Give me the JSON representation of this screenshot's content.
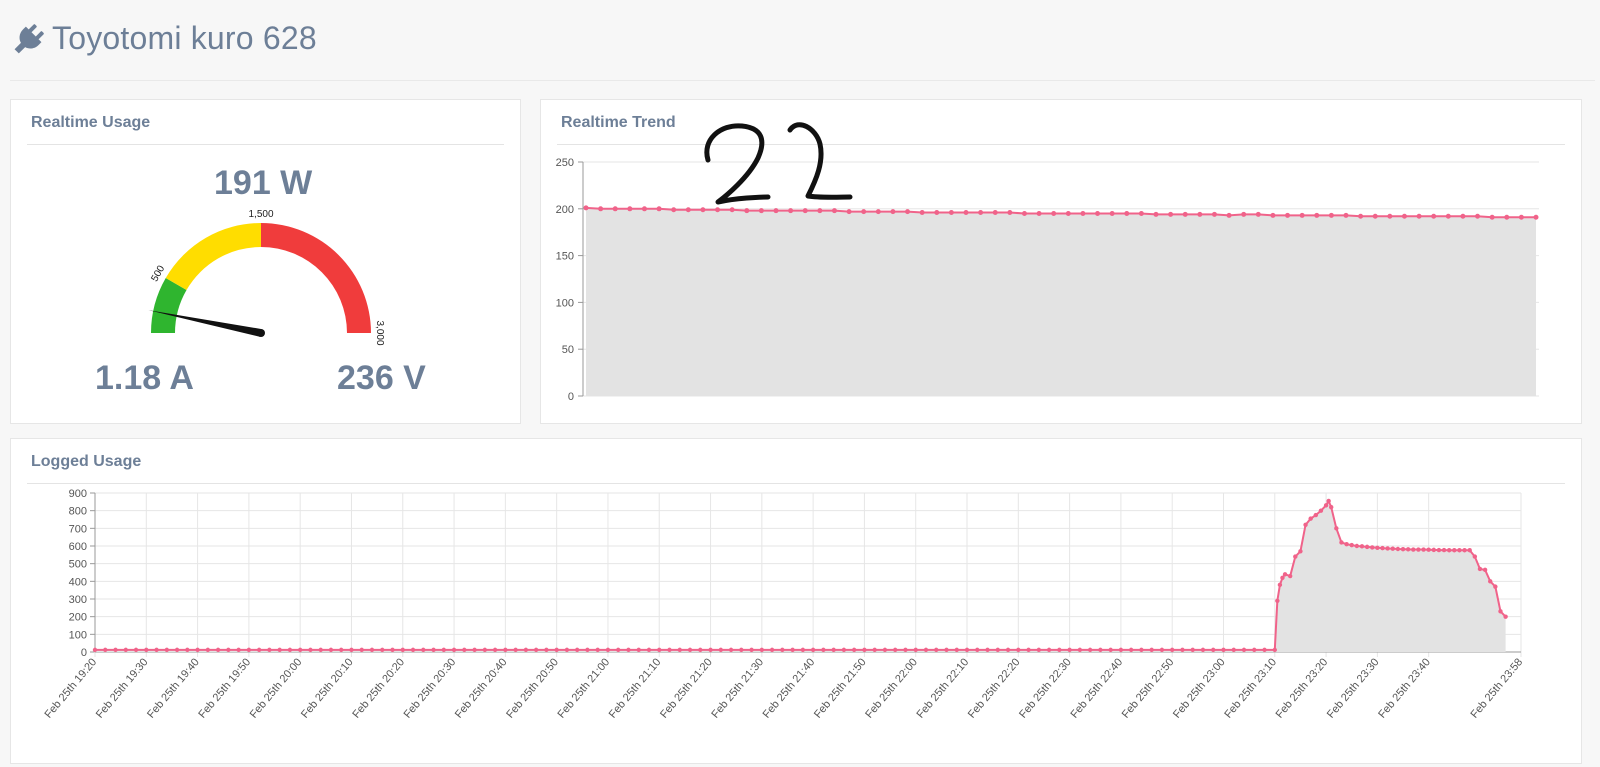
{
  "header": {
    "title": "Toyotomi kuro 628",
    "icon": "plug-icon"
  },
  "realtime_usage": {
    "title": "Realtime Usage",
    "power": "191 W",
    "current": "1.18 A",
    "voltage": "236 V",
    "gauge": {
      "min": 0,
      "max": 3000,
      "value": 191,
      "bands": [
        {
          "from": 0,
          "to": 500,
          "color": "#2fb52f"
        },
        {
          "from": 500,
          "to": 1500,
          "color": "#ffdd00"
        },
        {
          "from": 1500,
          "to": 3000,
          "color": "#f03c3c"
        }
      ],
      "tick_labels": [
        "500",
        "1,500",
        "3,000"
      ]
    }
  },
  "annotation": {
    "text": "22"
  },
  "chart_data": [
    {
      "type": "area",
      "title": "Realtime Trend",
      "ylim": [
        0,
        250
      ],
      "yticks": [
        "0",
        "50",
        "100",
        "150",
        "200",
        "250"
      ],
      "grid": true,
      "legend": "none",
      "line_color": "#f0638a",
      "fill_color": "#e3e3e3",
      "series": [
        {
          "values": [
            201,
            200,
            200,
            200,
            200,
            200,
            199,
            199,
            199,
            199,
            199,
            198,
            198,
            198,
            198,
            198,
            198,
            198,
            197,
            197,
            197,
            197,
            197,
            196,
            196,
            196,
            196,
            196,
            196,
            196,
            195,
            195,
            195,
            195,
            195,
            195,
            195,
            195,
            195,
            194,
            194,
            194,
            194,
            194,
            193,
            194,
            194,
            193,
            193,
            193,
            193,
            193,
            193,
            192,
            192,
            192,
            192,
            192,
            192,
            192,
            192,
            192,
            191,
            191,
            191,
            191
          ]
        }
      ]
    },
    {
      "type": "area",
      "title": "Logged Usage",
      "ylim": [
        0,
        900
      ],
      "yticks": [
        "0",
        "100",
        "200",
        "300",
        "400",
        "500",
        "600",
        "700",
        "800",
        "900"
      ],
      "grid": true,
      "legend": "none",
      "line_color": "#f0638a",
      "fill_color": "#e3e3e3",
      "x_tick_labels": [
        "Feb 25th 19:20",
        "Feb 25th 19:30",
        "Feb 25th 19:40",
        "Feb 25th 19:50",
        "Feb 25th 20:00",
        "Feb 25th 20:10",
        "Feb 25th 20:20",
        "Feb 25th 20:30",
        "Feb 25th 20:40",
        "Feb 25th 20:50",
        "Feb 25th 21:00",
        "Feb 25th 21:10",
        "Feb 25th 21:20",
        "Feb 25th 21:30",
        "Feb 25th 21:40",
        "Feb 25th 21:50",
        "Feb 25th 22:00",
        "Feb 25th 22:10",
        "Feb 25th 22:20",
        "Feb 25th 22:30",
        "Feb 25th 22:40",
        "Feb 25th 22:50",
        "Feb 25th 23:00",
        "Feb 25th 23:10",
        "Feb 25th 23:20",
        "Feb 25th 23:30",
        "Feb 25th 23:40",
        "Feb 25th 23:58"
      ],
      "series": [
        {
          "points": [
            [
              "19:20",
              12
            ],
            [
              "19:22",
              12
            ],
            [
              "19:24",
              12
            ],
            [
              "19:26",
              12
            ],
            [
              "19:28",
              12
            ],
            [
              "19:30",
              12
            ],
            [
              "19:32",
              12
            ],
            [
              "19:34",
              12
            ],
            [
              "19:36",
              12
            ],
            [
              "19:38",
              12
            ],
            [
              "19:40",
              12
            ],
            [
              "19:42",
              12
            ],
            [
              "19:44",
              12
            ],
            [
              "19:46",
              12
            ],
            [
              "19:48",
              12
            ],
            [
              "19:50",
              12
            ],
            [
              "19:52",
              12
            ],
            [
              "19:54",
              12
            ],
            [
              "19:56",
              12
            ],
            [
              "19:58",
              12
            ],
            [
              "20:00",
              12
            ],
            [
              "20:02",
              12
            ],
            [
              "20:04",
              12
            ],
            [
              "20:06",
              12
            ],
            [
              "20:08",
              12
            ],
            [
              "20:10",
              12
            ],
            [
              "20:12",
              12
            ],
            [
              "20:14",
              12
            ],
            [
              "20:16",
              12
            ],
            [
              "20:18",
              12
            ],
            [
              "20:20",
              12
            ],
            [
              "20:22",
              12
            ],
            [
              "20:24",
              12
            ],
            [
              "20:26",
              12
            ],
            [
              "20:28",
              12
            ],
            [
              "20:30",
              12
            ],
            [
              "20:32",
              12
            ],
            [
              "20:34",
              12
            ],
            [
              "20:36",
              12
            ],
            [
              "20:38",
              12
            ],
            [
              "20:40",
              12
            ],
            [
              "20:42",
              12
            ],
            [
              "20:44",
              12
            ],
            [
              "20:46",
              12
            ],
            [
              "20:48",
              12
            ],
            [
              "20:50",
              12
            ],
            [
              "20:52",
              12
            ],
            [
              "20:54",
              12
            ],
            [
              "20:56",
              12
            ],
            [
              "20:58",
              12
            ],
            [
              "21:00",
              12
            ],
            [
              "21:02",
              12
            ],
            [
              "21:04",
              12
            ],
            [
              "21:06",
              12
            ],
            [
              "21:08",
              12
            ],
            [
              "21:10",
              12
            ],
            [
              "21:12",
              12
            ],
            [
              "21:14",
              12
            ],
            [
              "21:16",
              12
            ],
            [
              "21:18",
              12
            ],
            [
              "21:20",
              12
            ],
            [
              "21:22",
              12
            ],
            [
              "21:24",
              12
            ],
            [
              "21:26",
              12
            ],
            [
              "21:28",
              12
            ],
            [
              "21:30",
              12
            ],
            [
              "21:32",
              12
            ],
            [
              "21:34",
              12
            ],
            [
              "21:36",
              12
            ],
            [
              "21:38",
              12
            ],
            [
              "21:40",
              12
            ],
            [
              "21:42",
              12
            ],
            [
              "21:44",
              12
            ],
            [
              "21:46",
              12
            ],
            [
              "21:48",
              12
            ],
            [
              "21:50",
              12
            ],
            [
              "21:52",
              12
            ],
            [
              "21:54",
              12
            ],
            [
              "21:56",
              12
            ],
            [
              "21:58",
              12
            ],
            [
              "22:00",
              12
            ],
            [
              "22:02",
              12
            ],
            [
              "22:04",
              12
            ],
            [
              "22:06",
              12
            ],
            [
              "22:08",
              12
            ],
            [
              "22:10",
              12
            ],
            [
              "22:12",
              12
            ],
            [
              "22:14",
              12
            ],
            [
              "22:16",
              12
            ],
            [
              "22:18",
              12
            ],
            [
              "22:20",
              12
            ],
            [
              "22:22",
              12
            ],
            [
              "22:24",
              12
            ],
            [
              "22:26",
              12
            ],
            [
              "22:28",
              12
            ],
            [
              "22:30",
              12
            ],
            [
              "22:32",
              12
            ],
            [
              "22:34",
              12
            ],
            [
              "22:36",
              12
            ],
            [
              "22:38",
              12
            ],
            [
              "22:40",
              12
            ],
            [
              "22:42",
              12
            ],
            [
              "22:44",
              12
            ],
            [
              "22:46",
              12
            ],
            [
              "22:48",
              12
            ],
            [
              "22:50",
              12
            ],
            [
              "22:52",
              12
            ],
            [
              "22:54",
              12
            ],
            [
              "22:56",
              12
            ],
            [
              "22:58",
              12
            ],
            [
              "23:00",
              12
            ],
            [
              "23:02",
              12
            ],
            [
              "23:04",
              12
            ],
            [
              "23:06",
              12
            ],
            [
              "23:08",
              12
            ],
            [
              "23:10",
              12
            ],
            [
              "23:10.5",
              290
            ],
            [
              "23:11",
              380
            ],
            [
              "23:11.5",
              420
            ],
            [
              "23:12",
              440
            ],
            [
              "23:13",
              430
            ],
            [
              "23:14",
              540
            ],
            [
              "23:15",
              570
            ],
            [
              "23:16",
              720
            ],
            [
              "23:17",
              755
            ],
            [
              "23:18",
              775
            ],
            [
              "23:19",
              800
            ],
            [
              "23:20",
              830
            ],
            [
              "23:20.5",
              855
            ],
            [
              "23:21",
              820
            ],
            [
              "23:22",
              700
            ],
            [
              "23:23",
              620
            ],
            [
              "23:24",
              610
            ],
            [
              "23:25",
              605
            ],
            [
              "23:26",
              600
            ],
            [
              "23:27",
              598
            ],
            [
              "23:28",
              595
            ],
            [
              "23:29",
              592
            ],
            [
              "23:30",
              590
            ],
            [
              "23:31",
              588
            ],
            [
              "23:32",
              586
            ],
            [
              "23:33",
              585
            ],
            [
              "23:34",
              583
            ],
            [
              "23:35",
              582
            ],
            [
              "23:36",
              581
            ],
            [
              "23:37",
              580
            ],
            [
              "23:38",
              580
            ],
            [
              "23:39",
              580
            ],
            [
              "23:40",
              579
            ],
            [
              "23:41",
              578
            ],
            [
              "23:42",
              577
            ],
            [
              "23:43",
              577
            ],
            [
              "23:44",
              576
            ],
            [
              "23:45",
              576
            ],
            [
              "23:46",
              576
            ],
            [
              "23:47",
              576
            ],
            [
              "23:48",
              576
            ],
            [
              "23:49",
              540
            ],
            [
              "23:50",
              470
            ],
            [
              "23:51",
              465
            ],
            [
              "23:52",
              400
            ],
            [
              "23:53",
              370
            ],
            [
              "23:54",
              230
            ],
            [
              "23:55",
              200
            ]
          ]
        }
      ]
    }
  ]
}
